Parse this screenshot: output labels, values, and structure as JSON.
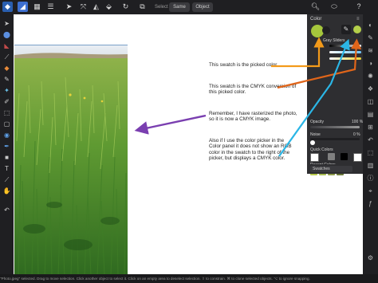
{
  "toolbar": {
    "select_label": "Select",
    "same_label": "Same",
    "object_label": "Object"
  },
  "panel": {
    "title": "Color",
    "mode_label": "Gray Sliders",
    "opacity_label": "Opacity",
    "opacity_value": "100 %",
    "noise_label": "Noise",
    "noise_value": "0 %",
    "quick_colors_label": "Quick Colors",
    "recent_colors_label": "Recent Colors",
    "swatches_label": "Swatches",
    "picked_color": "#a5c63c",
    "cmyk_color": "#b4cf4a",
    "recent_colors": [
      "#b7c94b",
      "#a9bd52",
      "#8f9c4a",
      "#6d7a3a"
    ],
    "quick_colors": [
      "#ffffff",
      "#808080",
      "#000000",
      "#ffffff"
    ]
  },
  "annotations": {
    "note1": "This swatch is the picked color.",
    "note2": "This swatch is the CMYK conversion of this picked color.",
    "note3": "Remember, I have rasterized the photo, so it is now a CMYK image.",
    "note4": "Also if I use the color picker in the Color panel it does not show an RGB color in the swatch to the right of the picker, but displays a CMYK color."
  },
  "status_bar": {
    "text": "\"Photo.jpeg\" selected. Drag to move selection. Click another object to select it. Click on an empty area to deselect selection. ⇧ to constrain. ⌘ to clone selected objects. ⌥ to ignore snapping."
  },
  "arrow_colors": {
    "orange": "#f39a1a",
    "dark_orange": "#e0651a",
    "purple": "#7a3fb0",
    "cyan": "#2bb6e6"
  }
}
